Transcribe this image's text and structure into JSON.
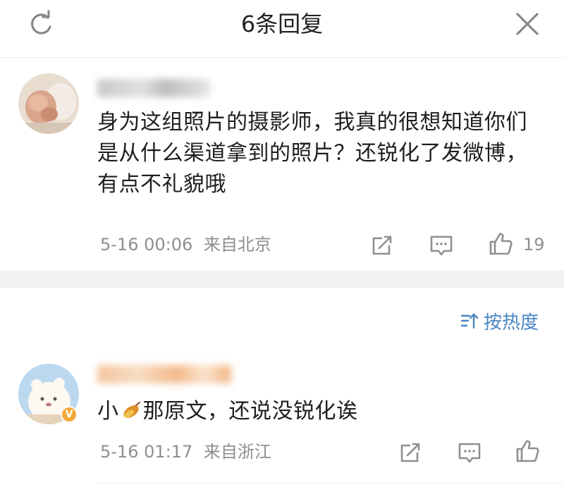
{
  "header": {
    "title": "6条回复",
    "refresh_icon": "refresh-icon",
    "close_icon": "close-icon"
  },
  "comments": [
    {
      "text": "身为这组照片的摄影师，我真的很想知道你们是从什么渠道拿到的照片？还锐化了发微博，有点不礼貌哦",
      "time": "5-16 00:06",
      "location": "来自北京",
      "like_count": "19"
    },
    {
      "text_prefix": "小",
      "text_suffix": "那原文，还说没锐化诶",
      "emoji": "sweet-potato-emoji",
      "time": "5-16 01:17",
      "location": "来自浙江",
      "verified_badge": "V"
    }
  ],
  "sort": {
    "label": "按热度",
    "icon": "sort-icon"
  },
  "colors": {
    "link_blue": "#4a86c4",
    "meta_gray": "#8f8f8f",
    "divider_gray": "#f1f1f1",
    "badge_orange": "#f2a93b"
  }
}
